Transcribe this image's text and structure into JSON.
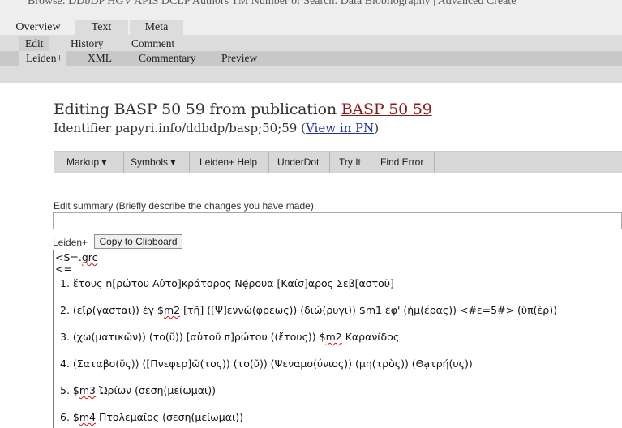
{
  "top_strip": {
    "text": "Browse:  DDbDP    HGV    APIS    DCLP    Authors    TM Number    or Search:    Data    Biobliography    |    Advanced Create"
  },
  "tabs_level1": [
    {
      "label": "Overview"
    },
    {
      "label": "Text"
    },
    {
      "label": "Meta"
    }
  ],
  "tabs_level2": [
    {
      "label": "Edit"
    },
    {
      "label": "History"
    },
    {
      "label": "Comment"
    }
  ],
  "tabs_level3": [
    {
      "label": "Leiden+"
    },
    {
      "label": "XML"
    },
    {
      "label": "Commentary"
    },
    {
      "label": "Preview"
    }
  ],
  "heading": {
    "prefix": "Editing BASP 50 59 from publication ",
    "link": "BASP 50 59"
  },
  "identifier": {
    "prefix": "Identifier papyri.info/ddbdp/basp;50;59 (",
    "link": "View in PN",
    "suffix": ")"
  },
  "toolbar": [
    {
      "label": "Markup ▾"
    },
    {
      "label": "Symbols ▾"
    },
    {
      "label": "Leiden+ Help"
    },
    {
      "label": "UnderDot"
    },
    {
      "label": "Try It"
    },
    {
      "label": "Find Error"
    }
  ],
  "edit_summary": {
    "label": "Edit summary (Briefly describe the changes you have made):",
    "value": ""
  },
  "leiden": {
    "label": "Leiden+",
    "copy_button": "Copy to Clipboard"
  },
  "editor": {
    "header_line1_prefix": "<S=.",
    "header_line1_squiggly": "grc",
    "header_line2": "<=",
    "lines": [
      {
        "num": "1.",
        "pre": "ἔτους ṇ[ρώτου Αὐτο]κράτορος Νẹ́ρουα [Καίσ]αρος Σεβ[αστοῦ]",
        "sq": "",
        "post": ""
      },
      {
        "num": "2.",
        "pre": "(εἴρ(γασται)) ἐγ $",
        "sq": "m2",
        "post": " [τῆ] ([Ψ]εννώ(φρεως)) (διώ(ρυγι)) $m1 ἐφ' (ἡμ(έρας)) <#ε=5#> (ὑπ(ὲρ))"
      },
      {
        "num": "3.",
        "pre": "(χω(ματικῶν)) (το(ῦ)) [αὐτοῦ π]ρώτου ((ἔτους)) $",
        "sq": "m2",
        "post": " Καρανίδος"
      },
      {
        "num": "4.",
        "pre": "(Σαταβο(ῦς)) ([Πνεφερ]ῶ(τος)) (το(ῦ)) (Ψεναμο(ύνιος)) (μη(τρὸς)) (Θạτρή(υς))",
        "sq": "",
        "post": ""
      },
      {
        "num": "5.",
        "pre": "$",
        "sq": "m3",
        "post": " Ὡρίων (σεση(μείωμαι))"
      },
      {
        "num": "6.",
        "pre": "$",
        "sq": "m4",
        "post": " Πτολεμαῖος (σεση(μείωμαι))"
      }
    ]
  }
}
